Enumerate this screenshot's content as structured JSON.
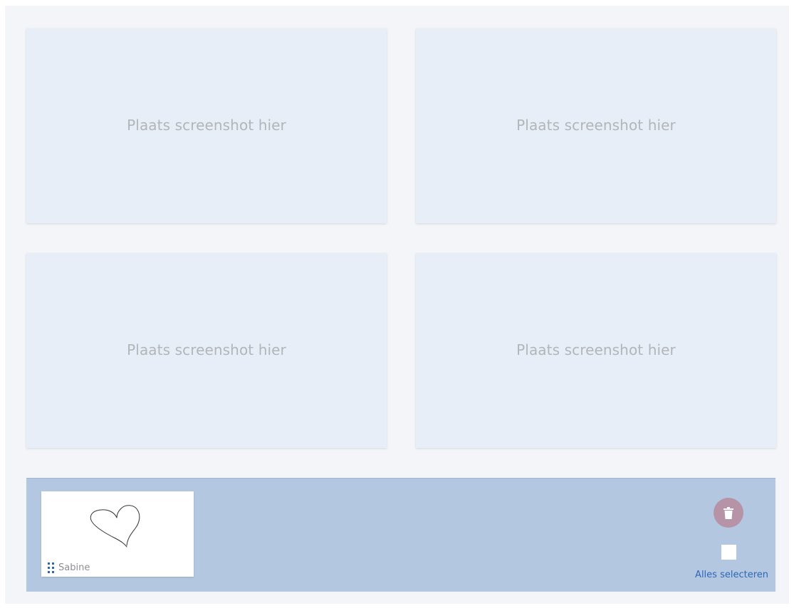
{
  "slots": [
    {
      "placeholder": "Plaats screenshot hier"
    },
    {
      "placeholder": "Plaats screenshot hier"
    },
    {
      "placeholder": "Plaats screenshot hier"
    },
    {
      "placeholder": "Plaats screenshot hier"
    }
  ],
  "tray": {
    "cards": [
      {
        "name": "Sabine",
        "drawing": "heart-sketch",
        "handle_icon": "drag-handle-icon"
      }
    ],
    "delete_icon": "trash-icon",
    "select_all_label": "Alles selecteren",
    "select_all_checked": false
  },
  "colors": {
    "canvas": "#f3f5f9",
    "slot": "#e7eef7",
    "tray": "#b3c8e0",
    "delete_button": "#b693a7",
    "accent": "#2e66b8"
  }
}
